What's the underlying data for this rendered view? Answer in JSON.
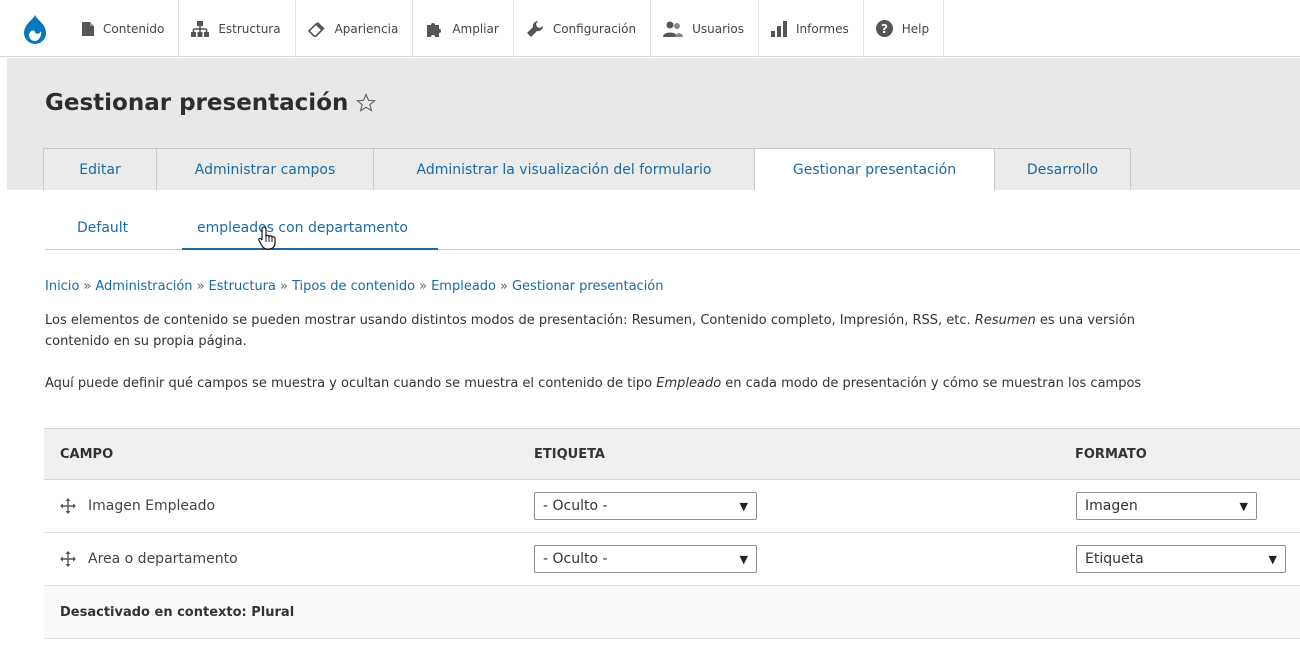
{
  "toolbar": {
    "items": [
      {
        "label": "Contenido",
        "icon": "page-icon"
      },
      {
        "label": "Estructura",
        "icon": "sitemap-icon"
      },
      {
        "label": "Apariencia",
        "icon": "paintbrush-icon"
      },
      {
        "label": "Ampliar",
        "icon": "puzzle-icon"
      },
      {
        "label": "Configuración",
        "icon": "wrench-icon"
      },
      {
        "label": "Usuarios",
        "icon": "users-icon"
      },
      {
        "label": "Informes",
        "icon": "bar-chart-icon"
      },
      {
        "label": "Help",
        "icon": "question-icon"
      }
    ]
  },
  "page": {
    "title": "Gestionar presentación"
  },
  "tabs": [
    {
      "label": "Editar"
    },
    {
      "label": "Administrar campos"
    },
    {
      "label": "Administrar la visualización del formulario"
    },
    {
      "label": "Gestionar presentación"
    },
    {
      "label": "Desarrollo"
    }
  ],
  "subtabs": [
    {
      "label": "Default"
    },
    {
      "label": "empleados con departamento"
    }
  ],
  "breadcrumb": [
    "Inicio",
    "Administración",
    "Estructura",
    "Tipos de contenido",
    "Empleado",
    "Gestionar presentación"
  ],
  "breadcrumb_sep": "»",
  "description": {
    "p1_line1_start": "Los elementos de contenido se pueden mostrar usando distintos modos de presentación: Resumen, Contenido completo, Impresión, RSS, etc. ",
    "p1_line1_em": "Resumen",
    "p1_line1_end": " es una versión",
    "p1_line2": "contenido en su propia página.",
    "p2_start": "Aquí puede definir qué campos se muestra y ocultan cuando se muestra el contenido de tipo ",
    "p2_em": "Empleado",
    "p2_end": " en cada modo de presentación y cómo se muestran los campos"
  },
  "table": {
    "headers": {
      "campo": "CAMPO",
      "etiqueta": "ETIQUETA",
      "formato": "FORMATO"
    },
    "rows": [
      {
        "field": "Imagen Empleado",
        "label_select": "- Oculto -",
        "format_select": "Imagen"
      },
      {
        "field": "Area o departamento",
        "label_select": "- Oculto -",
        "format_select": "Etiqueta"
      }
    ],
    "region_label": "Desactivado en contexto: Plural"
  },
  "colors": {
    "link": "#1b6aa8",
    "header_bg": "#e8e8e6",
    "drupal_blue": "#0678be"
  }
}
